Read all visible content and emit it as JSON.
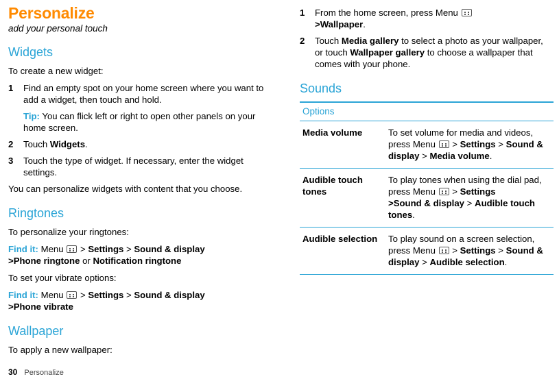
{
  "document": {
    "title": "Personalize",
    "subtitle": "add your personal touch",
    "footer_page": "30",
    "footer_chapter": "Personalize",
    "accent_orange": "#ff8a00",
    "accent_blue": "#2aa4d6"
  },
  "left_column": {
    "widgets": {
      "heading": "Widgets",
      "intro": "To create a new widget:",
      "steps": [
        {
          "num": "1",
          "text": "Find an empty spot on your home screen where you want to add a widget, then touch and hold."
        },
        {
          "num": "2",
          "pre": "Touch ",
          "bold": "Widgets",
          "post": "."
        },
        {
          "num": "3",
          "text": "Touch the type of widget. If necessary, enter the widget settings."
        }
      ],
      "tip_label": "Tip:",
      "tip_text": " You can flick left or right to open other panels on your home screen.",
      "outro": "You can personalize widgets with content that you choose."
    },
    "ringtones": {
      "heading": "Ringtones",
      "intro": "To personalize your ringtones:",
      "findit_label": "Find it:",
      "findit_1_a": " Menu ",
      "findit_1_b": " > ",
      "findit_1_settings": "Settings",
      "findit_1_sep": " > ",
      "findit_1_sound": "Sound & display",
      "findit_1_line2_gt": ">",
      "findit_1_phone_ringtone": "Phone ringtone",
      "findit_1_or": " or ",
      "findit_1_notification": "Notification ringtone",
      "vibrate_intro": "To set your vibrate options:",
      "findit_2_a": " Menu ",
      "findit_2_b": " > ",
      "findit_2_settings": "Settings",
      "findit_2_sep": " > ",
      "findit_2_sound": "Sound & display",
      "findit_2_line2_gt": ">",
      "findit_2_phone_vibrate": "Phone vibrate"
    },
    "wallpaper": {
      "heading": "Wallpaper",
      "intro": "To apply a new wallpaper:"
    }
  },
  "right_column": {
    "wallpaper_steps": [
      {
        "num": "1",
        "pre": "From the home screen, press Menu ",
        "line2_gt": ">",
        "bold": "Wallpaper",
        "post": "."
      },
      {
        "num": "2",
        "pre": "Touch ",
        "bold1": "Media gallery",
        "mid": " to select a photo as your wallpaper, or touch ",
        "bold2": "Wallpaper gallery",
        "post": " to choose a wallpaper that comes with your phone."
      }
    ],
    "sounds": {
      "heading": "Sounds",
      "table_header": "Options",
      "rows": [
        {
          "option": "Media volume",
          "parts": {
            "t1": "To set volume for media and videos, press Menu ",
            "t2": " > ",
            "b1": "Settings",
            "t3": " > ",
            "b2": "Sound & display",
            "t4": " > ",
            "b3": "Media volume",
            "t5": "."
          }
        },
        {
          "option": "Audible touch tones",
          "parts": {
            "t1": "To play tones when using the dial pad, press Menu ",
            "t2": " > ",
            "b1": "Settings",
            "t3": ">",
            "b2": "Sound & display",
            "t4": " > ",
            "b3": "Audible touch tones",
            "t5": "."
          }
        },
        {
          "option": "Audible selection",
          "parts": {
            "t1": "To play sound on a screen selection, press Menu ",
            "t2": " > ",
            "b1": "Settings",
            "t3": " > ",
            "b2": "Sound & display",
            "t4": " > ",
            "b3": "Audible selection",
            "t5": "."
          }
        }
      ]
    }
  }
}
